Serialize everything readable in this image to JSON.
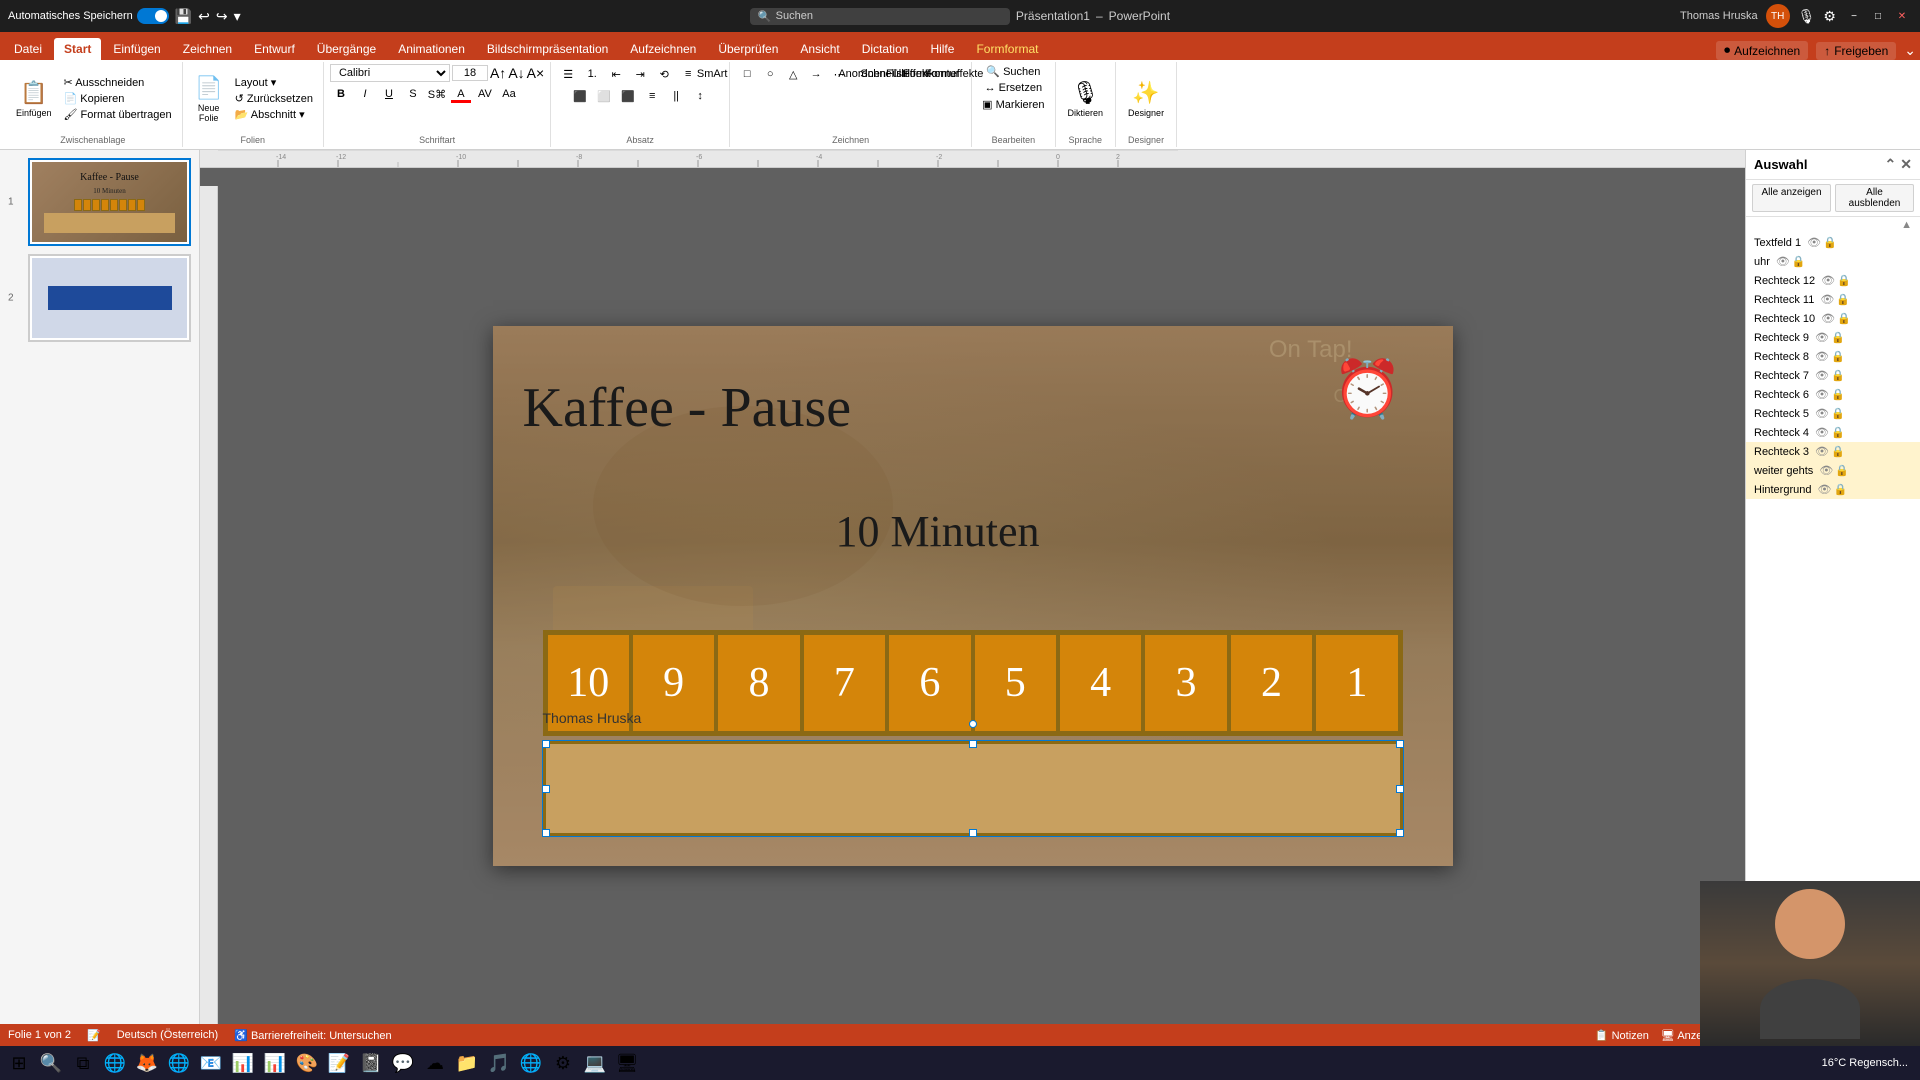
{
  "titlebar": {
    "autosave_label": "Automatisches Speichern",
    "filename": "Präsentation1",
    "app": "PowerPoint",
    "search_placeholder": "Suchen",
    "user": "Thomas Hruska",
    "min_btn": "−",
    "max_btn": "□",
    "close_btn": "✕"
  },
  "ribbon": {
    "tabs": [
      {
        "id": "datei",
        "label": "Datei"
      },
      {
        "id": "start",
        "label": "Start",
        "active": true
      },
      {
        "id": "einfuegen",
        "label": "Einfügen"
      },
      {
        "id": "zeichnen",
        "label": "Zeichnen"
      },
      {
        "id": "entwurf",
        "label": "Entwurf"
      },
      {
        "id": "uebergaenge",
        "label": "Übergänge"
      },
      {
        "id": "animationen",
        "label": "Animationen"
      },
      {
        "id": "bildschirm",
        "label": "Bildschirmpräsentation"
      },
      {
        "id": "aufzeichnen",
        "label": "Aufzeichnen"
      },
      {
        "id": "ueberpruefen",
        "label": "Überprüfen"
      },
      {
        "id": "ansicht",
        "label": "Ansicht"
      },
      {
        "id": "dictation",
        "label": "Dictation"
      },
      {
        "id": "hilfe",
        "label": "Hilfe"
      },
      {
        "id": "formformat",
        "label": "Formformat",
        "special": true
      }
    ],
    "groups": {
      "zwischenablage": {
        "label": "Zwischenablage",
        "buttons": [
          "Einfügen",
          "Ausschneiden",
          "Kopieren",
          "Format übertragen"
        ]
      },
      "folien": {
        "label": "Folien",
        "buttons": [
          "Neue Folie",
          "Layout",
          "Zurücksetzen",
          "Abschnitt"
        ]
      },
      "schriftart": {
        "label": "Schriftart",
        "font": "Calibri",
        "size": "18"
      },
      "absatz": {
        "label": "Absatz"
      },
      "zeichnen": {
        "label": "Zeichnen"
      },
      "bearbeiten": {
        "label": "Bearbeiten",
        "buttons": [
          "Suchen",
          "Ersetzen",
          "Markieren"
        ]
      },
      "sprache": {
        "label": "Sprache",
        "buttons": [
          "Diktieren"
        ]
      },
      "designer": {
        "label": "Designer"
      }
    },
    "record_btn": "Aufzeichnen",
    "share_btn": "Freigeben"
  },
  "slide_panel": {
    "slides": [
      {
        "number": 1,
        "title": "Kaffee - Pause",
        "subtitle": "10 Minuten"
      },
      {
        "number": 2,
        "title": ""
      }
    ]
  },
  "slide": {
    "title": "Kaffee - Pause",
    "subtitle": "10 Minuten",
    "author": "Thomas Hruska",
    "countdown": {
      "numbers": [
        "10",
        "9",
        "8",
        "7",
        "6",
        "5",
        "4",
        "3",
        "2",
        "1"
      ]
    }
  },
  "selection_panel": {
    "title": "Auswahl",
    "show_all": "Alle anzeigen",
    "hide_all": "Alle ausblenden",
    "items": [
      {
        "name": "Textfeld 1",
        "visible": true,
        "locked": false
      },
      {
        "name": "uhr",
        "visible": true,
        "locked": false
      },
      {
        "name": "Rechteck 12",
        "visible": true,
        "locked": false
      },
      {
        "name": "Rechteck 11",
        "visible": true,
        "locked": false
      },
      {
        "name": "Rechteck 10",
        "visible": true,
        "locked": false
      },
      {
        "name": "Rechteck 9",
        "visible": true,
        "locked": false
      },
      {
        "name": "Rechteck 8",
        "visible": true,
        "locked": false
      },
      {
        "name": "Rechteck 7",
        "visible": true,
        "locked": false
      },
      {
        "name": "Rechteck 6",
        "visible": true,
        "locked": false
      },
      {
        "name": "Rechteck 5",
        "visible": true,
        "locked": false
      },
      {
        "name": "Rechteck 4",
        "visible": true,
        "locked": false
      },
      {
        "name": "Rechteck 3",
        "visible": true,
        "locked": false,
        "highlighted": true
      },
      {
        "name": "weiter gehts",
        "visible": true,
        "locked": false,
        "highlighted": true
      },
      {
        "name": "Hintergrund",
        "visible": true,
        "locked": false,
        "highlighted": true
      }
    ]
  },
  "status_bar": {
    "slide_info": "Folie 1 von 2",
    "language": "Deutsch (Österreich)",
    "accessibility": "Barrierefreiheit: Untersuchen",
    "notes": "Notizen",
    "view_settings": "Anzeigeeinstellungen"
  },
  "taskbar": {
    "time": "16°C  Regensch...",
    "apps": [
      "⊞",
      "🔍",
      "📁",
      "🌐",
      "🦊",
      "🌐",
      "📧",
      "📊",
      "📈",
      "🎨",
      "📝",
      "📋",
      "🔔",
      "📱",
      "💬",
      "📁",
      "🎵",
      "🌐",
      "💻",
      "🖥"
    ]
  }
}
